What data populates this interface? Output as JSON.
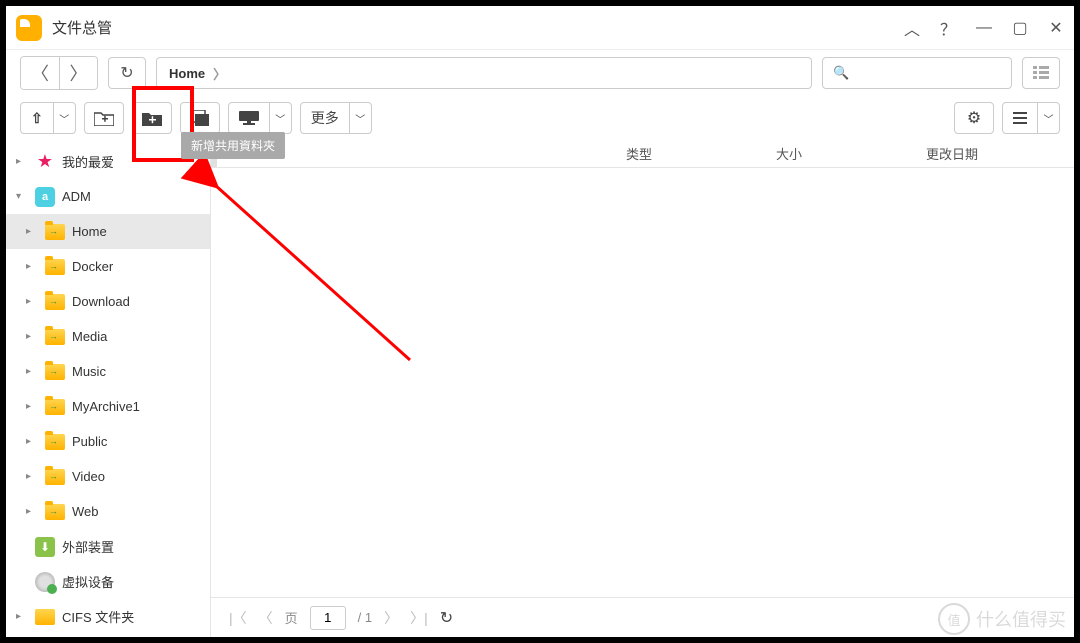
{
  "app": {
    "title": "文件总管"
  },
  "breadcrumb": {
    "path": "Home"
  },
  "toolbar": {
    "more_label": "更多",
    "tooltip": "新增共用資料夾"
  },
  "columns": {
    "type": "类型",
    "size": "大小",
    "date": "更改日期"
  },
  "sidebar": {
    "favorites": "我的最爱",
    "adm": "ADM",
    "folders": [
      "Home",
      "Docker",
      "Download",
      "Media",
      "Music",
      "MyArchive1",
      "Public",
      "Video",
      "Web"
    ],
    "external": "外部装置",
    "virtual": "虚拟设备",
    "cifs": "CIFS 文件夹"
  },
  "pagination": {
    "page_label": "页",
    "current": "1",
    "total": "/ 1"
  },
  "watermark": {
    "badge": "值",
    "text": "什么值得买"
  }
}
